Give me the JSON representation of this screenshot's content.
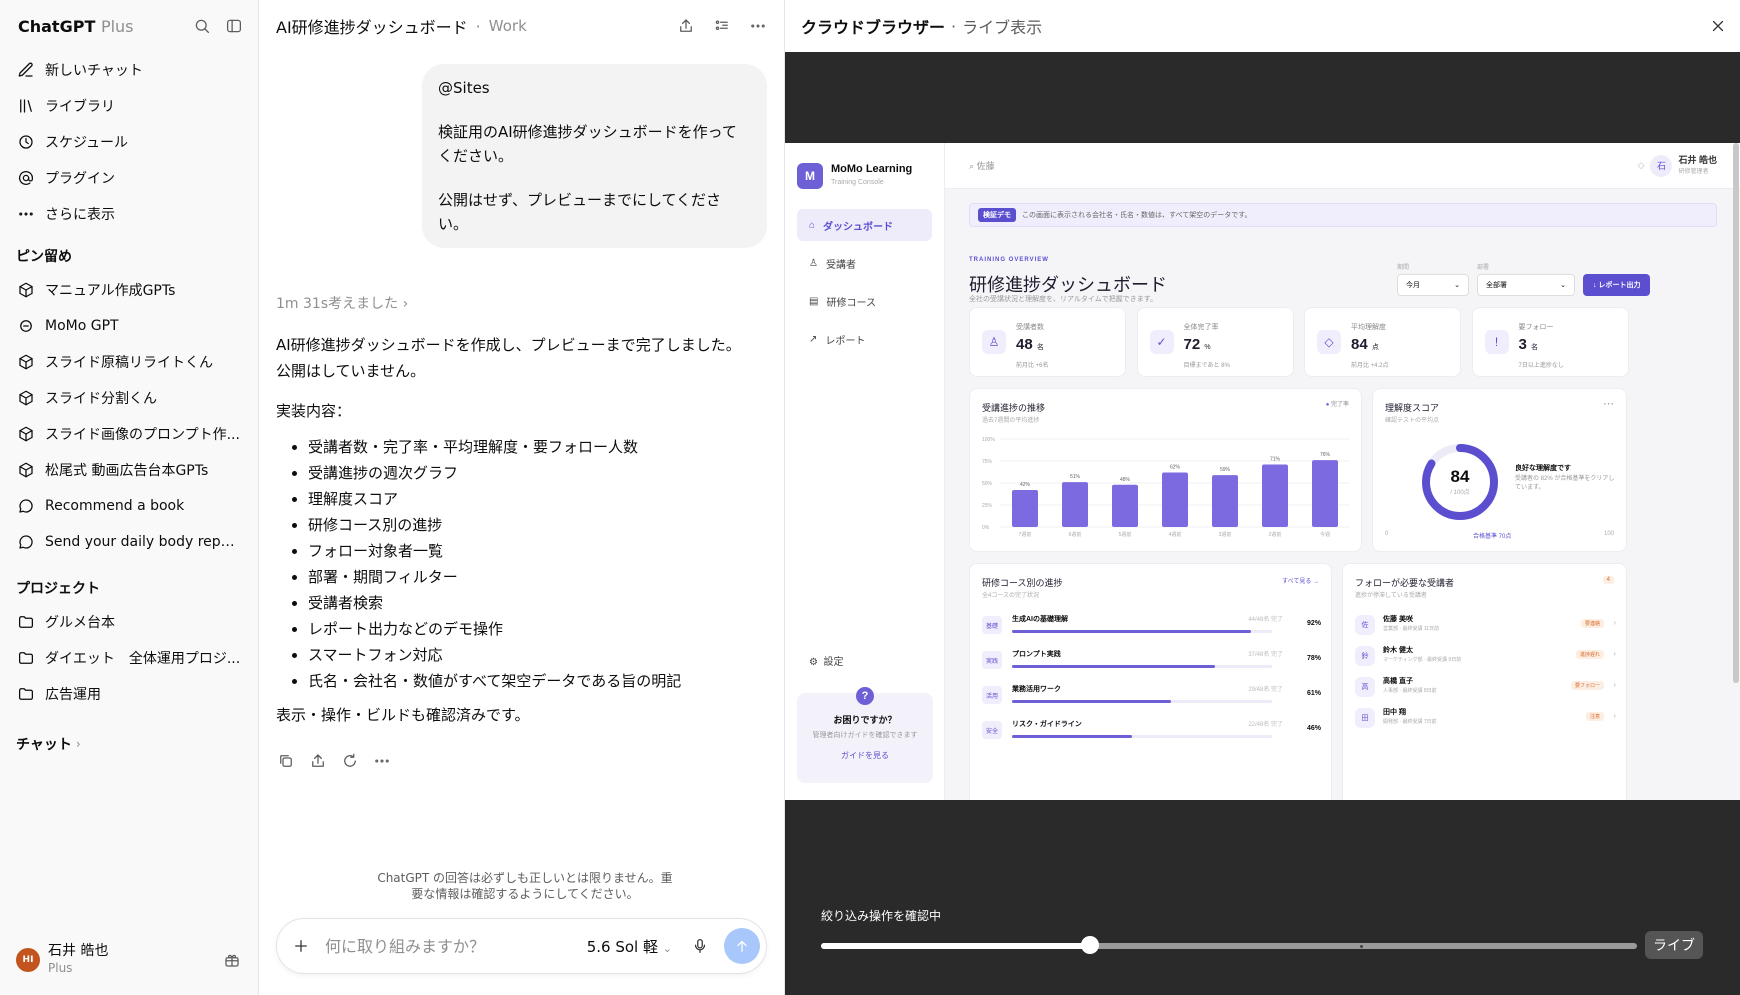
{
  "sidebar": {
    "brand": "ChatGPT",
    "plan_badge": "Plus",
    "nav": [
      {
        "label": "新しいチャット",
        "icon": "new-chat-icon"
      },
      {
        "label": "ライブラリ",
        "icon": "library-icon"
      },
      {
        "label": "スケジュール",
        "icon": "clock-icon"
      },
      {
        "label": "プラグイン",
        "icon": "at-icon"
      },
      {
        "label": "さらに表示",
        "icon": "more-icon"
      }
    ],
    "pinned_title": "ピン留め",
    "pinned": [
      {
        "label": "マニュアル作成GPTs",
        "icon": "cube-icon"
      },
      {
        "label": "MoMo GPT",
        "icon": "gpt-avatar-icon"
      },
      {
        "label": "スライド原稿リライトくん",
        "icon": "cube-icon"
      },
      {
        "label": "スライド分割くん",
        "icon": "cube-icon"
      },
      {
        "label": "スライド画像のプロンプト作...",
        "icon": "cube-icon"
      },
      {
        "label": "松尾式 動画広告台本GPTs",
        "icon": "cube-icon"
      },
      {
        "label": "Recommend a book",
        "icon": "chat-bubble-icon"
      },
      {
        "label": "Send your daily body report now",
        "icon": "chat-bubble-icon"
      }
    ],
    "projects_title": "プロジェクト",
    "projects": [
      {
        "label": "グルメ台本",
        "icon": "folder-icon"
      },
      {
        "label": "ダイエット　全体運用プロジ...",
        "icon": "folder-icon"
      },
      {
        "label": "広告運用",
        "icon": "folder-icon"
      }
    ],
    "chats_title": "チャット",
    "user": {
      "initials": "HI",
      "name": "石井 皓也",
      "plan": "Plus"
    }
  },
  "chat": {
    "title": "AI研修進捗ダッシュボード",
    "project": "Work",
    "user_message": [
      "@Sites",
      "検証用のAI研修進捗ダッシュボードを作ってください。",
      "公開はせず、プレビューまでにしてください。"
    ],
    "thought": "1m 31s考えました",
    "answer_intro": "AI研修進捗ダッシュボードを作成し、プレビューまで完了しました。公開はしていません。",
    "answer_heading": "実装内容：",
    "answer_items": [
      "受講者数・完了率・平均理解度・要フォロー人数",
      "受講進捗の週次グラフ",
      "理解度スコア",
      "研修コース別の進捗",
      "フォロー対象者一覧",
      "部署・期間フィルター",
      "受講者検索",
      "レポート出力などのデモ操作",
      "スマートフォン対応",
      "氏名・会社名・数値がすべて架空データである旨の明記"
    ],
    "answer_outro": "表示・操作・ビルドも確認済みです。",
    "disclaimer": "ChatGPT の回答は必ずしも正しいとは限りません。重要な情報は確認するようにしてください。",
    "composer_placeholder": "何に取り組みますか？",
    "model_label": "5.6 Sol 軽"
  },
  "browser": {
    "title": "クラウドブラウザー",
    "subtitle": "ライブ表示",
    "status": "絞り込み操作を確認中",
    "live_label": "ライブ",
    "slider_position": 0.33,
    "slider_tick": 0.66,
    "site": {
      "brand": "MoMo Learning",
      "brand_sub": "Training Console",
      "nav": [
        {
          "label": "ダッシュボード",
          "icon": "home-icon",
          "active": true
        },
        {
          "label": "受講者",
          "icon": "user-icon",
          "active": false
        },
        {
          "label": "研修コース",
          "icon": "book-icon",
          "active": false
        },
        {
          "label": "レポート",
          "icon": "trend-icon",
          "active": false
        }
      ],
      "settings": "設定",
      "help_title": "お困りですか？",
      "help_text": "管理者向けガイドを確認できます",
      "help_link": "ガイドを見る",
      "search_value": "佐藤",
      "user_initial": "石",
      "user_name": "石井 皓也",
      "user_role": "研修管理者",
      "banner_badge": "検証デモ",
      "banner_text": "この画面に表示される会社名・氏名・数値は、すべて架空のデータです。",
      "eyebrow": "TRAINING OVERVIEW",
      "title": "研修進捗ダッシュボード",
      "subtitle": "全社の受講状況と理解度を、リアルタイムで把握できます。",
      "filter_period_label": "期間",
      "filter_period": "今月",
      "filter_dept_label": "部署",
      "filter_dept": "全部署",
      "report_button": "↓ レポート出力",
      "kpis": [
        {
          "label": "受講者数",
          "value": "48",
          "unit": "名",
          "note": "前月比 +6名",
          "icon": "user-icon"
        },
        {
          "label": "全体完了率",
          "value": "72",
          "unit": "%",
          "note": "目標まであと 8%",
          "icon": "check-icon"
        },
        {
          "label": "平均理解度",
          "value": "84",
          "unit": "点",
          "note": "前月比 +4.2点",
          "icon": "diamond-icon"
        },
        {
          "label": "要フォロー",
          "value": "3",
          "unit": "名",
          "note": "7日以上進捗なし",
          "icon": "alert-icon"
        }
      ],
      "progress_title": "受講進捗の推移",
      "progress_sub": "過去7週間の平均進捗",
      "progress_legend": "完了率",
      "score_title": "理解度スコア",
      "score_sub": "確認テストの平均点",
      "score_value": "84",
      "score_max": "/ 100点",
      "score_comment": "良好な理解度です",
      "score_comment_sub": "受講者の 82% が合格基準をクリアしています。",
      "score_axis_min": "0",
      "score_axis_max": "100",
      "score_pass": "合格基準 70点",
      "courses_title": "研修コース別の進捗",
      "courses_sub": "全4コースの完了状況",
      "courses_link": "すべて見る →",
      "courses": [
        {
          "tag": "基礎",
          "name": "生成AIの基礎理解",
          "meta": "44/48名 完了",
          "pct": 92
        },
        {
          "tag": "実践",
          "name": "プロンプト実践",
          "meta": "37/48名 完了",
          "pct": 78
        },
        {
          "tag": "活用",
          "name": "業務活用ワーク",
          "meta": "29/48名 完了",
          "pct": 61
        },
        {
          "tag": "安全",
          "name": "リスク・ガイドライン",
          "meta": "22/48名 完了",
          "pct": 46
        }
      ],
      "follow_title": "フォローが必要な受講者",
      "follow_sub": "進捗が停滞している受講者",
      "follow_count": "4",
      "follow": [
        {
          "initial": "佐",
          "name": "佐藤 美咲",
          "meta": "営業部 · 最終受講 11日前",
          "badge": "要連絡"
        },
        {
          "initial": "鈴",
          "name": "鈴木 健太",
          "meta": "マーケティング部 · 最終受講 9日前",
          "badge": "進捗遅れ"
        },
        {
          "initial": "高",
          "name": "高橋 直子",
          "meta": "人事部 · 最終受講 8日前",
          "badge": "要フォロー"
        },
        {
          "initial": "田",
          "name": "田中 翔",
          "meta": "開発部 · 最終受講 7日前",
          "badge": "注意"
        }
      ]
    }
  },
  "chart_data": {
    "type": "bar",
    "title": "受講進捗の推移",
    "categories": [
      "7週前",
      "6週前",
      "5週前",
      "4週前",
      "3週前",
      "2週前",
      "今週"
    ],
    "values": [
      42,
      51,
      48,
      62,
      59,
      71,
      76
    ],
    "ylim": [
      0,
      100
    ],
    "yticks": [
      "0%",
      "25%",
      "50%",
      "75%",
      "100%"
    ],
    "value_labels": [
      "42%",
      "51%",
      "48%",
      "62%",
      "59%",
      "71%",
      "76%"
    ]
  },
  "colors": {
    "accent": "#6d5fd6",
    "bar": "#7b6ae0",
    "send": "#a8c7fa",
    "avatar": "#c2541d"
  }
}
